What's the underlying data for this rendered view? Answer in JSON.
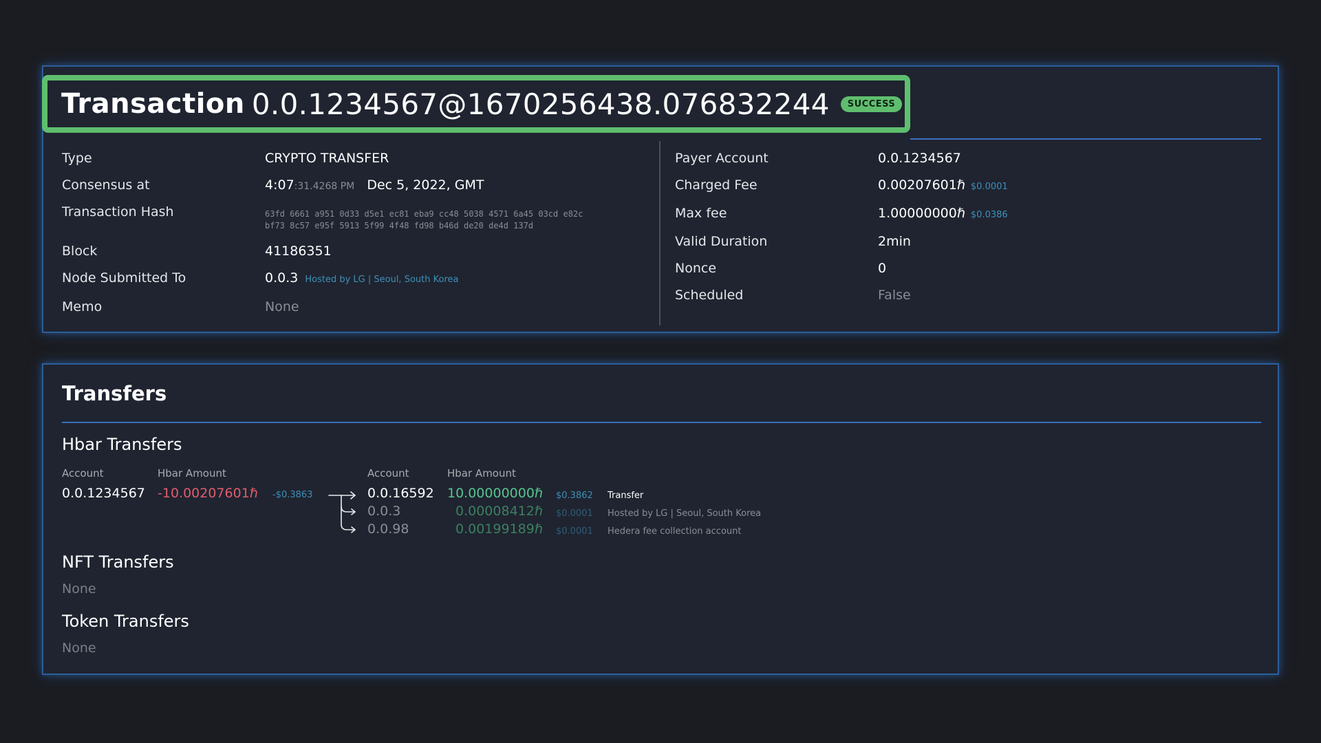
{
  "transaction": {
    "title_word": "Transaction",
    "id": "0.0.1234567@1670256438.076832244",
    "status": "SUCCESS",
    "left": {
      "type_label": "Type",
      "type_value": "CRYPTO TRANSFER",
      "consensus_label": "Consensus at",
      "consensus_time": "4:07",
      "consensus_seconds": ":31.4268 PM",
      "consensus_date": "Dec 5, 2022, GMT",
      "hash_label": "Transaction Hash",
      "hash_line1": "63fd 6661 a951 0d33 d5e1 ec81 eba9 cc48 5038 4571 6a45 03cd e82c",
      "hash_line2": "bf73 8c57 e95f 5913 5f99 4f48 fd98 b46d de20 de4d 137d",
      "block_label": "Block",
      "block_value": "41186351",
      "node_label": "Node Submitted To",
      "node_value": "0.0.3",
      "node_host": "Hosted by LG | Seoul, South Korea",
      "memo_label": "Memo",
      "memo_value": "None"
    },
    "right": {
      "payer_label": "Payer Account",
      "payer_value": "0.0.1234567",
      "charged_label": "Charged Fee",
      "charged_value": "0.00207601ℏ",
      "charged_usd": "$0.0001",
      "maxfee_label": "Max fee",
      "maxfee_value": "1.00000000ℏ",
      "maxfee_usd": "$0.0386",
      "duration_label": "Valid Duration",
      "duration_value": "2min",
      "nonce_label": "Nonce",
      "nonce_value": "0",
      "scheduled_label": "Scheduled",
      "scheduled_value": "False"
    }
  },
  "transfers": {
    "title": "Transfers",
    "hbar_title": "Hbar Transfers",
    "col_account": "Account",
    "col_amount": "Hbar Amount",
    "from": {
      "account": "0.0.1234567",
      "amount": "-10.00207601ℏ",
      "usd": "-$0.3863"
    },
    "to": [
      {
        "account": "0.0.16592",
        "amount": "10.00000000ℏ",
        "usd": "$0.3862",
        "desc": "Transfer"
      },
      {
        "account": "0.0.3",
        "amount": "0.00008412ℏ",
        "usd": "$0.0001",
        "desc": "Hosted by LG | Seoul, South Korea"
      },
      {
        "account": "0.0.98",
        "amount": "0.00199189ℏ",
        "usd": "$0.0001",
        "desc": "Hedera fee collection account"
      }
    ],
    "nft_title": "NFT Transfers",
    "nft_value": "None",
    "token_title": "Token Transfers",
    "token_value": "None"
  },
  "colors": {
    "success": "#5fbe6e",
    "accent_blue": "#3a6fc0",
    "negative": "#e05c6b",
    "positive": "#58c48e"
  },
  "icons": [
    "arrow-right-icon",
    "branch-arrow-icon"
  ]
}
